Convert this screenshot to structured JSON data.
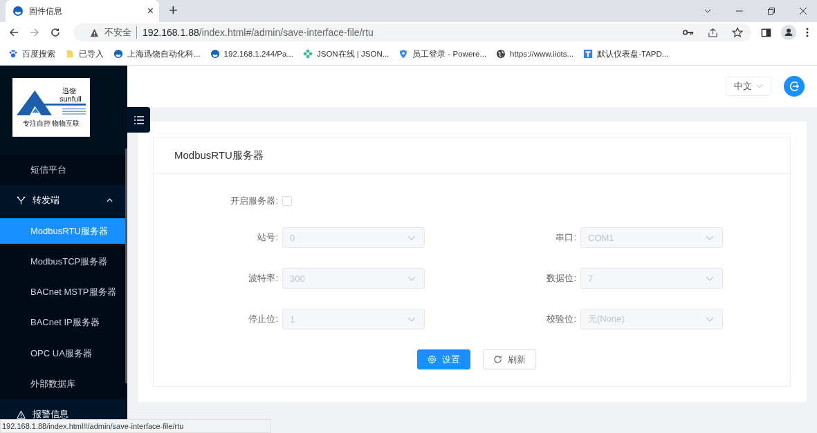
{
  "browser": {
    "tab": {
      "title": "固件信息",
      "close": "×"
    },
    "new_tab": "+",
    "address": {
      "security": "不安全",
      "host": "192.168.1.88",
      "path": "/index.html#/admin/save-interface-file/rtu"
    },
    "bookmarks": [
      {
        "label": "百度搜索",
        "kind": "paw"
      },
      {
        "label": "已导入",
        "kind": "folder"
      },
      {
        "label": "上海迅饶自动化科...",
        "kind": "logo"
      },
      {
        "label": "192.168.1.244/Pa...",
        "kind": "logo"
      },
      {
        "label": "JSON在线 | JSON...",
        "kind": "flower"
      },
      {
        "label": "员工登录 - Powere...",
        "kind": "shield"
      },
      {
        "label": "https://www.iiots...",
        "kind": "globe"
      },
      {
        "label": "默认仪表盘-TAPD...",
        "kind": "tapd"
      }
    ]
  },
  "logo": {
    "name_cn": "迅饶",
    "name_en": "sunfull",
    "slogan": "专注自控 物物互联"
  },
  "sidebar": {
    "items": [
      {
        "label": "短信平台",
        "kind": "sub",
        "selected": false
      },
      {
        "label": "转发端",
        "kind": "group",
        "expanded": true,
        "children": [
          {
            "label": "ModbusRTU服务器",
            "selected": true
          },
          {
            "label": "ModbusTCP服务器",
            "selected": false
          },
          {
            "label": "BACnet MSTP服务器",
            "selected": false
          },
          {
            "label": "BACnet IP服务器",
            "selected": false
          },
          {
            "label": "OPC UA服务器",
            "selected": false
          },
          {
            "label": "外部数据库",
            "selected": false
          }
        ]
      },
      {
        "label": "报警信息",
        "kind": "group",
        "expanded": false
      }
    ]
  },
  "header": {
    "language": "中文"
  },
  "form": {
    "title": "ModbusRTU服务器",
    "enable": {
      "label": "开启服务器:",
      "checked": false
    },
    "fields": [
      {
        "label": "站号:",
        "value": "0",
        "disabled": true
      },
      {
        "label": "串口:",
        "value": "COM1",
        "disabled": true
      },
      {
        "label": "波特率:",
        "value": "300",
        "disabled": true
      },
      {
        "label": "数据位:",
        "value": "7",
        "disabled": true
      },
      {
        "label": "停止位:",
        "value": "1",
        "disabled": true
      },
      {
        "label": "校验位:",
        "value": "无(None)",
        "disabled": true
      }
    ],
    "buttons": [
      {
        "label": "设置",
        "kind": "primary"
      },
      {
        "label": "刷新",
        "kind": "default"
      }
    ]
  },
  "status_bar": "192.168.1.88/index.html#/admin/save-interface-file/rtu"
}
